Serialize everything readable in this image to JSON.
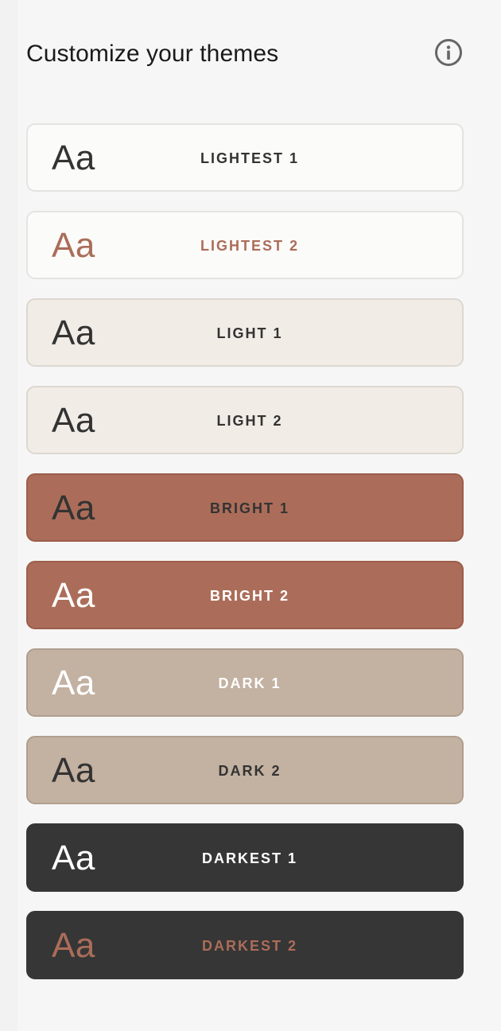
{
  "header": {
    "title": "Customize your themes",
    "info_icon": "info-icon"
  },
  "themes": [
    {
      "sample": "Aa",
      "label": "LIGHTEST 1",
      "bg": "#fbfbfa",
      "border": "#e4e4e2",
      "sample_color": "#333333",
      "label_color": "#333333"
    },
    {
      "sample": "Aa",
      "label": "LIGHTEST 2",
      "bg": "#fbfbfa",
      "border": "#e4e4e2",
      "sample_color": "#ab6d59",
      "label_color": "#ab6d59"
    },
    {
      "sample": "Aa",
      "label": "LIGHT 1",
      "bg": "#f1ece6",
      "border": "#dcd8d1",
      "sample_color": "#333333",
      "label_color": "#333333"
    },
    {
      "sample": "Aa",
      "label": "LIGHT 2",
      "bg": "#f1ece6",
      "border": "#dcd8d1",
      "sample_color": "#333333",
      "label_color": "#333333"
    },
    {
      "sample": "Aa",
      "label": "BRIGHT 1",
      "bg": "#ab6d59",
      "border": "#9c5e4a",
      "sample_color": "#333333",
      "label_color": "#333333"
    },
    {
      "sample": "Aa",
      "label": "BRIGHT 2",
      "bg": "#ab6d59",
      "border": "#9c5e4a",
      "sample_color": "#ffffff",
      "label_color": "#ffffff"
    },
    {
      "sample": "Aa",
      "label": "DARK 1",
      "bg": "#c3b1a1",
      "border": "#b09e8e",
      "sample_color": "#ffffff",
      "label_color": "#ffffff"
    },
    {
      "sample": "Aa",
      "label": "DARK 2",
      "bg": "#c3b1a1",
      "border": "#b09e8e",
      "sample_color": "#333333",
      "label_color": "#333333"
    },
    {
      "sample": "Aa",
      "label": "DARKEST 1",
      "bg": "#363636",
      "border": "#363636",
      "sample_color": "#ffffff",
      "label_color": "#ffffff"
    },
    {
      "sample": "Aa",
      "label": "DARKEST 2",
      "bg": "#363636",
      "border": "#363636",
      "sample_color": "#ab6d59",
      "label_color": "#ab6d59"
    }
  ]
}
